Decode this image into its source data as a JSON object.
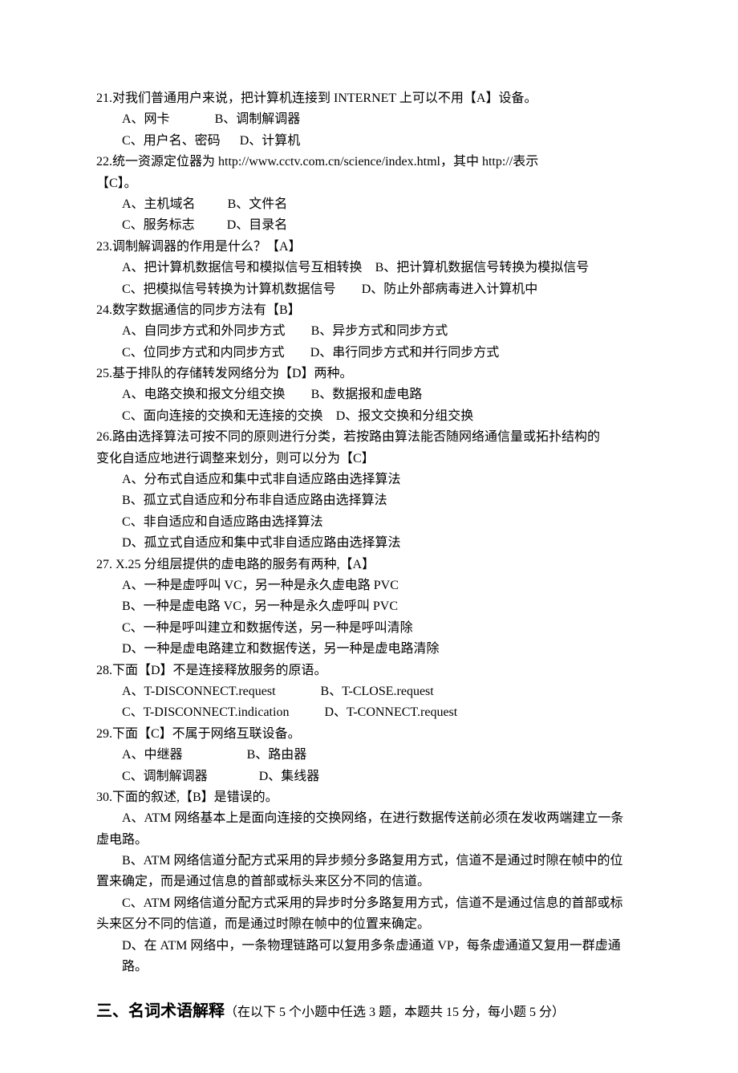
{
  "q21": {
    "stem": "21.对我们普通用户来说，把计算机连接到 INTERNET 上可以不用【A】设备。",
    "optA": "A、网卡",
    "optB": "B、调制解调器",
    "optC": "C、用户名、密码",
    "optD": "D、计算机"
  },
  "q22": {
    "stem": "22.统一资源定位器为 http://www.cctv.com.cn/science/index.html，其中 http://表示",
    "stem2": "【C】。",
    "optA": "A、主机域名",
    "optB": "B、文件名",
    "optC": "C、服务标志",
    "optD": "D、目录名"
  },
  "q23": {
    "stem": "23.调制解调器的作用是什么？【A】",
    "optA": "A、把计算机数据信号和模拟信号互相转换",
    "optB": "B、把计算机数据信号转换为模拟信号",
    "optC": "C、把模拟信号转换为计算机数据信号",
    "optD": "D、防止外部病毒进入计算机中"
  },
  "q24": {
    "stem": "24.数字数据通信的同步方法有【B】",
    "optA": "A、自同步方式和外同步方式",
    "optB": "B、异步方式和同步方式",
    "optC": "C、位同步方式和内同步方式",
    "optD": "D、串行同步方式和并行同步方式"
  },
  "q25": {
    "stem": "25.基于排队的存储转发网络分为【D】两种。",
    "optA": "A、电路交换和报文分组交换",
    "optB": "B、数据报和虚电路",
    "optC": "C、面向连接的交换和无连接的交换",
    "optD": "D、报文交换和分组交换"
  },
  "q26": {
    "stem": "26.路由选择算法可按不同的原则进行分类，若按路由算法能否随网络通信量或拓扑结构的",
    "stem2": "变化自适应地进行调整来划分，则可以分为【C】",
    "optA": "A、分布式自适应和集中式非自适应路由选择算法",
    "optB": "B、孤立式自适应和分布非自适应路由选择算法",
    "optC": "C、非自适应和自适应路由选择算法",
    "optD": "D、孤立式自适应和集中式非自适应路由选择算法"
  },
  "q27": {
    "stem": "27. X.25 分组层提供的虚电路的服务有两种,【A】",
    "optA": "A、一种是虚呼叫 VC，另一种是永久虚电路 PVC",
    "optB": "B、一种是虚电路 VC，另一种是永久虚呼叫 PVC",
    "optC": "C、一种是呼叫建立和数据传送，另一种是呼叫清除",
    "optD": "D、一种是虚电路建立和数据传送，另一种是虚电路清除"
  },
  "q28": {
    "stem": "28.下面【D】不是连接释放服务的原语。",
    "optA": "A、T-DISCONNECT.request",
    "optB": "B、T-CLOSE.request",
    "optC": "C、T-DISCONNECT.indication",
    "optD": "D、T-CONNECT.request"
  },
  "q29": {
    "stem": "29.下面【C】不属于网络互联设备。",
    "optA": "A、中继器",
    "optB": "B、路由器",
    "optC": "C、调制解调器",
    "optD": "D、集线器"
  },
  "q30": {
    "stem": "30.下面的叙述,【B】是错误的。",
    "optA": "A、ATM 网络基本上是面向连接的交换网络，在进行数据传送前必须在发收两端建立一条",
    "optA2": "虚电路。",
    "optB": "B、ATM 网络信道分配方式采用的异步频分多路复用方式，信道不是通过时隙在帧中的位",
    "optB2": "置来确定，而是通过信息的首部或标头来区分不同的信道。",
    "optC": "C、ATM 网络信道分配方式采用的异步时分多路复用方式，信道不是通过信息的首部或标",
    "optC2": "头来区分不同的信道，而是通过时隙在帧中的位置来确定。",
    "optD": "D、在 ATM 网络中，一条物理链路可以复用多条虚通道 VP，每条虚通道又复用一群虚通路。"
  },
  "section3": {
    "title": "三、名词术语解释",
    "note": "（在以下 5 个小题中任选 3 题，本题共 15 分，每小题 5 分）"
  }
}
